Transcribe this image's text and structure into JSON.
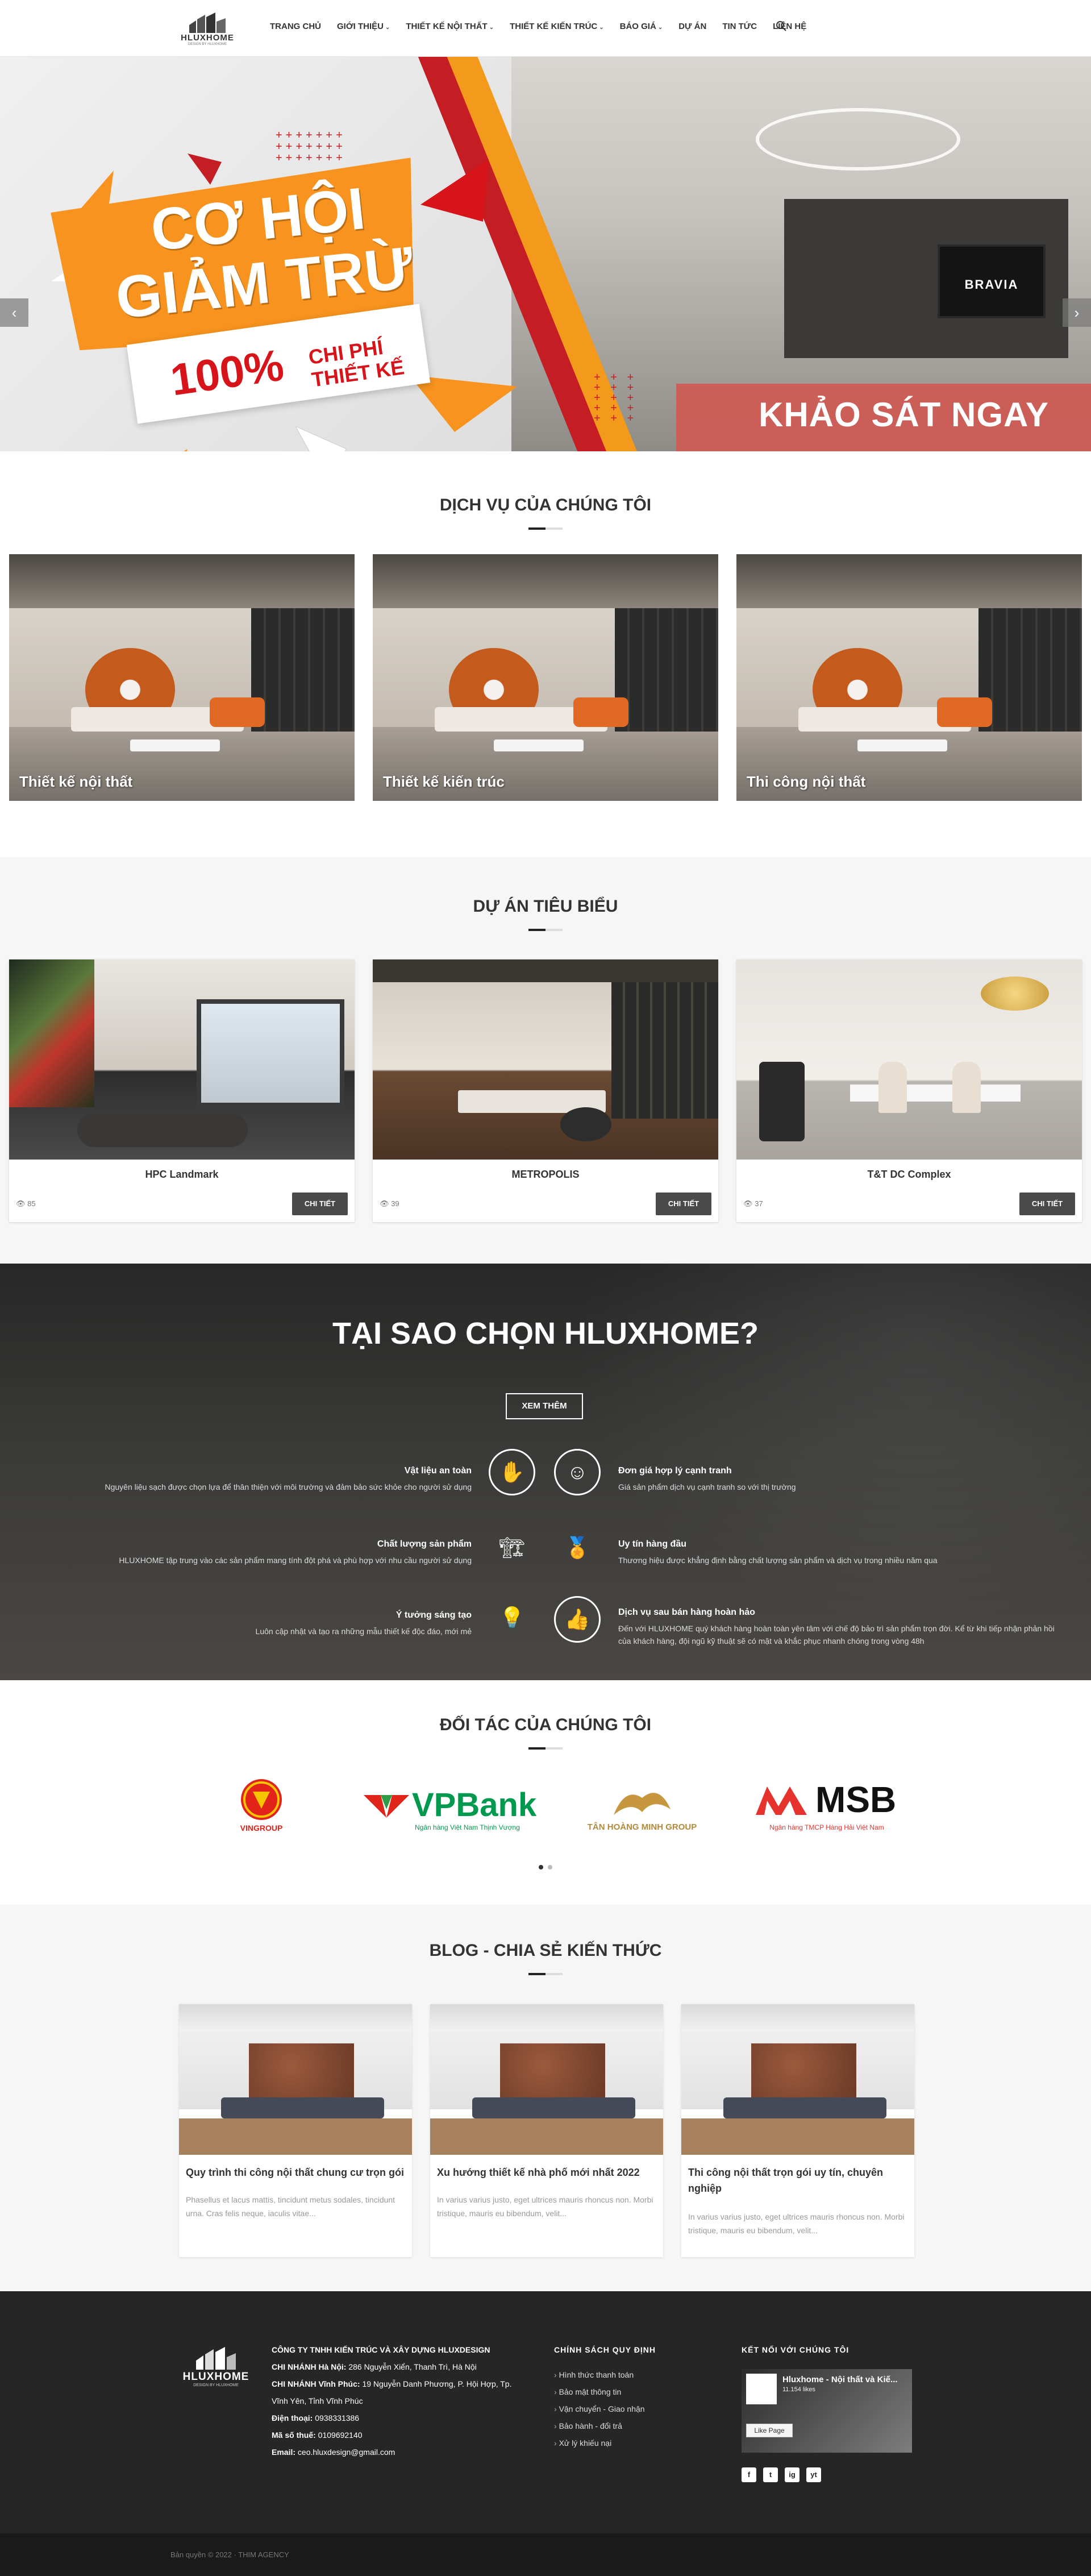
{
  "header": {
    "logo_text": "HLUXHOME",
    "logo_sub": "DESIGN BY HLUXHOME",
    "nav": [
      {
        "label": "TRANG CHỦ",
        "has_dropdown": false
      },
      {
        "label": "GIỚI THIỆU",
        "has_dropdown": true
      },
      {
        "label": "THIẾT KẾ NỘI THẤT",
        "has_dropdown": true
      },
      {
        "label": "THIẾT KẾ KIẾN TRÚC",
        "has_dropdown": true
      },
      {
        "label": "BÁO GIÁ",
        "has_dropdown": true
      },
      {
        "label": "DỰ ÁN",
        "has_dropdown": false
      },
      {
        "label": "TIN TỨC",
        "has_dropdown": false
      },
      {
        "label": "LIÊN HỆ",
        "has_dropdown": false
      }
    ],
    "search_icon": "search-icon"
  },
  "banner": {
    "headline": "CƠ HỘI GIẢM TRỪ",
    "percent": "100%",
    "sub": "CHI PHÍ THIẾT KẾ",
    "tv_brand": "BRAVIA",
    "cta": "KHẢO SÁT NGAY",
    "arrow_prev": "‹",
    "arrow_next": "›"
  },
  "services": {
    "title": "DỊCH VỤ CỦA CHÚNG TÔI",
    "items": [
      {
        "label": "Thiết kế nội thất"
      },
      {
        "label": "Thiết kế kiến trúc"
      },
      {
        "label": "Thi công nội thất"
      }
    ]
  },
  "projects": {
    "title": "DỰ ÁN TIÊU BIỂU",
    "button_label": "CHI TIẾT",
    "items": [
      {
        "name": "HPC Landmark",
        "views": "85"
      },
      {
        "name": "METROPOLIS",
        "views": "39"
      },
      {
        "name": "T&T DC Complex",
        "views": "37"
      }
    ]
  },
  "why": {
    "title": "TẠI SAO CHỌN HLUXHOME?",
    "button_label": "XEM THÊM",
    "left": [
      {
        "heading": "Vật liệu an toàn",
        "desc": "Nguyên liệu sạch được chọn lựa để thân thiện với môi trường và đảm bảo sức khỏe cho người sử dụng",
        "icon": "hand-icon"
      },
      {
        "heading": "Chất lượng sản phẩm",
        "desc": "HLUXHOME tập trung vào các sản phẩm mang tính đột phá và phù hợp với nhu cầu người sử dụng",
        "icon": "crane-icon"
      },
      {
        "heading": "Ý tưởng sáng tạo",
        "desc": "Luôn cập nhật và tạo ra những mẫu thiết kế độc đáo, mới mẻ",
        "icon": "lightbulb-icon"
      }
    ],
    "right": [
      {
        "heading": "Đơn giá hợp lý cạnh tranh",
        "desc": "Giá sản phẩm dịch vụ cạnh tranh so với thị trường",
        "icon": "money-icon"
      },
      {
        "heading": "Uy tín hàng đầu",
        "desc": "Thương hiệu được khẳng định bằng chất lượng sản phẩm và dịch vụ trong nhiều năm qua",
        "icon": "medal-icon"
      },
      {
        "heading": "Dịch vụ sau bán hàng hoàn hảo",
        "desc": "Đến với HLUXHOME quý khách hàng hoàn toàn yên tâm với chế độ bảo trì sản phẩm trọn đời. Kể từ khi tiếp nhận phản hồi của khách hàng, đội ngũ kỹ thuật sẽ có mặt và khắc phục nhanh chóng trong vòng 48h",
        "icon": "thumbs-up-icon"
      }
    ]
  },
  "partners": {
    "title": "ĐỐI TÁC CỦA CHÚNG TÔI",
    "items": [
      {
        "name": "VINGROUP"
      },
      {
        "name": "VPBank",
        "tagline": "Ngân hàng Việt Nam Thịnh Vượng"
      },
      {
        "name": "TÂN HOÀNG MINH GROUP"
      },
      {
        "name": "MSB",
        "tagline": "Ngân hàng TMCP Hàng Hải Việt Nam"
      }
    ]
  },
  "blog": {
    "title": "BLOG - CHIA SẺ KIẾN THỨC",
    "items": [
      {
        "title": "Quy trình thi công nội thất chung cư trọn gói",
        "excerpt": "Phasellus et lacus mattis, tincidunt metus sodales, tincidunt urna. Cras felis neque, iaculis vitae..."
      },
      {
        "title": "Xu hướng thiết kế nhà phố mới nhất 2022",
        "excerpt": "In varius varius justo, eget ultrices mauris rhoncus non. Morbi tristique, mauris eu bibendum, velit..."
      },
      {
        "title": "Thi công nội thất trọn gói uy tín, chuyên nghiệp",
        "excerpt": "In varius varius justo, eget ultrices mauris rhoncus non. Morbi tristique, mauris eu bibendum, velit..."
      }
    ]
  },
  "footer": {
    "logo_text": "HLUXHOME",
    "logo_sub": "DESIGN BY HLUXHOME",
    "company": "CÔNG TY TNHH KIẾN TRÚC VÀ XÂY DỰNG HLUXDESIGN",
    "branch1_label": "CHI NHÁNH Hà Nội:",
    "branch1_value": "286 Nguyễn Xiển, Thanh Trì, Hà Nội",
    "branch2_label": "CHI NHÁNH Vĩnh Phúc:",
    "branch2_value": "19 Nguyễn Danh Phương, P. Hội Hợp, Tp. Vĩnh Yên, Tỉnh Vĩnh Phúc",
    "phone_label": "Điện thoại:",
    "phone": "0938331386",
    "tax_label": "Mã số thuế:",
    "tax": "0109692140",
    "email_label": "Email:",
    "email": "ceo.hluxdesign@gmail.com",
    "policy_title": "CHÍNH SÁCH QUY ĐỊNH",
    "policies": [
      "Hình thức thanh toán",
      "Bảo mật thông tin",
      "Vận chuyển - Giao nhận",
      "Bảo hành - đổi trả",
      "Xử lý khiếu nại"
    ],
    "connect_title": "KẾT NỐI VỚI CHÚNG TÔI",
    "fb_name": "Hluxhome - Nội thất và Kiế...",
    "fb_likes": "11.154 likes",
    "fb_like_btn": "Like Page",
    "social": [
      "f",
      "t",
      "ig",
      "yt"
    ],
    "copyright": "Bản quyền © 2022 · THIM AGENCY"
  },
  "colors": {
    "accent_red": "#c41e24",
    "accent_orange": "#f7931e",
    "dark": "#262626"
  }
}
